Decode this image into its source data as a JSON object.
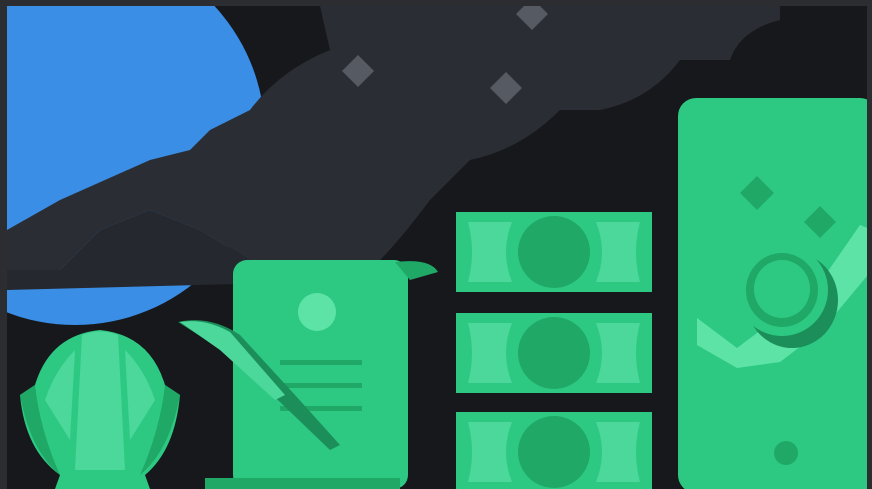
{
  "illustration": {
    "subject": "finance-banner",
    "elements": [
      "blue-planet",
      "cloud-band",
      "sparkle-diamonds",
      "scallop-shell",
      "quill-pen",
      "document-scroll",
      "banknote-stack",
      "phone-with-coin"
    ]
  },
  "colors": {
    "frame": "#2b2d31",
    "background": "#17181c",
    "cloud": "#2a2d34",
    "cloud_edge": "#25282e",
    "planet": "#3a8ee6",
    "diamond": "#555a63",
    "green": "#2dc983",
    "green_dark": "#1fa866",
    "green_light": "#4bd89a",
    "green_pale": "#5ee3a7",
    "green_deep": "#1b8e59"
  }
}
